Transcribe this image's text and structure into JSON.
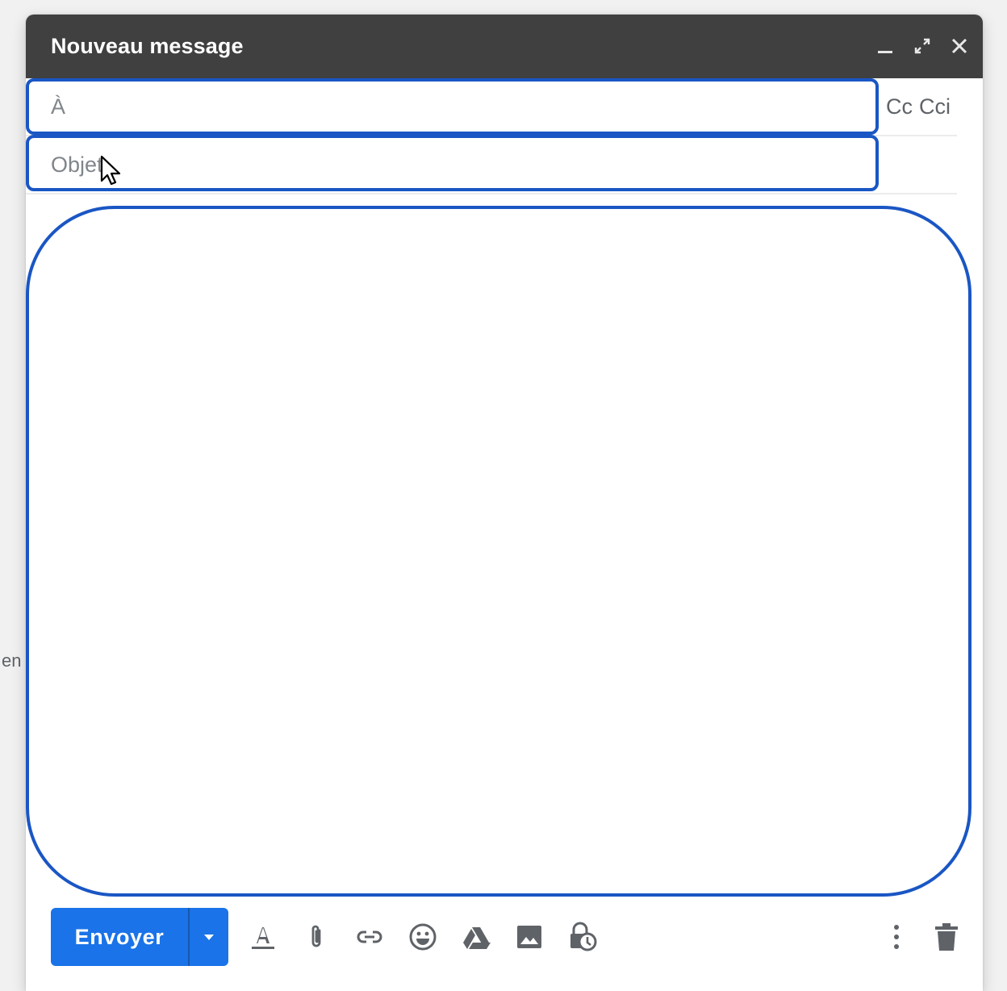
{
  "background": {
    "partial_text": "en"
  },
  "compose": {
    "title": "Nouveau message",
    "window_icons": [
      "minimize-icon",
      "expand-icon",
      "close-icon"
    ],
    "to": {
      "label": "À"
    },
    "cc_label": "Cc",
    "bcc_label": "Cci",
    "subject": {
      "placeholder": "Objet"
    },
    "send_label": "Envoyer",
    "toolbar_icons": [
      "text-format-icon",
      "attach-icon",
      "link-icon",
      "emoji-icon",
      "drive-icon",
      "photo-icon",
      "confidential-mode-icon"
    ],
    "right_icons": [
      "more-options-icon",
      "trash-icon"
    ]
  },
  "colors": {
    "titlebar": "#404040",
    "send_button": "#1a73e8",
    "highlight": "#1a56c4",
    "icon": "#5f6368"
  }
}
